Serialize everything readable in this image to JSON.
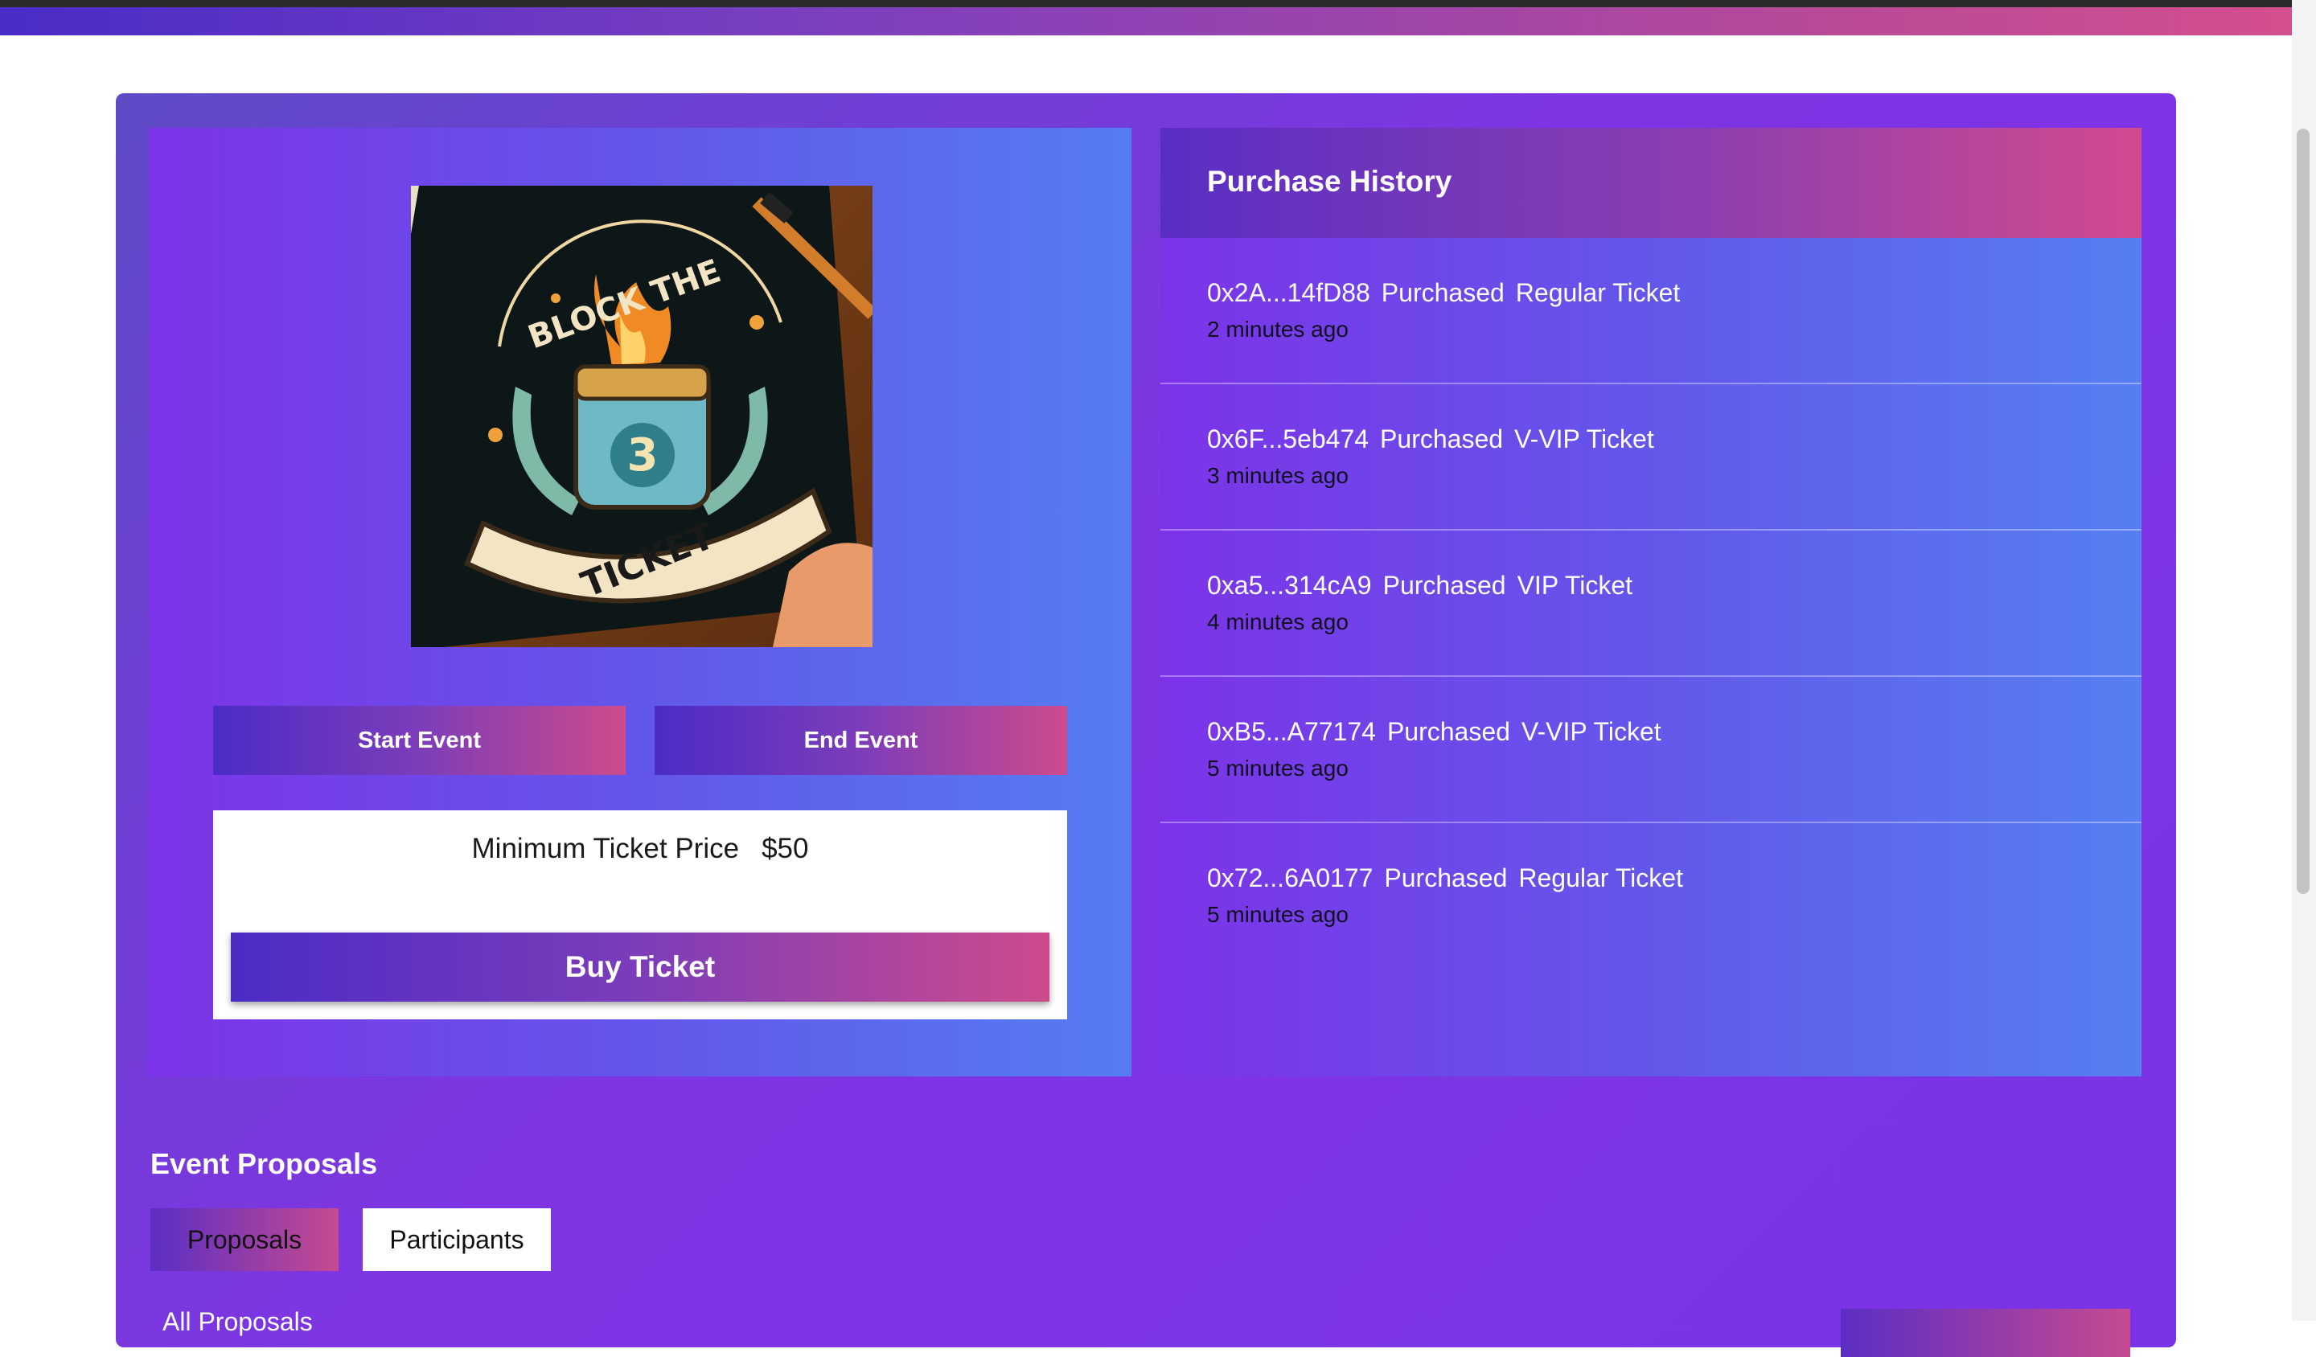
{
  "event": {
    "image_alt": "BLOCK THE 3 TICKET",
    "logo_text_top": "BLOCK THE",
    "logo_number": "3",
    "logo_text_bottom": "TICKET",
    "start_label": "Start Event",
    "end_label": "End Event",
    "min_price_label": "Minimum Ticket Price",
    "min_price_value": "$50",
    "buy_label": "Buy Ticket"
  },
  "history": {
    "title": "Purchase History",
    "items": [
      {
        "address": "0x2A...14fD88",
        "action": "Purchased",
        "ticket": "Regular Ticket",
        "time": "2 minutes ago"
      },
      {
        "address": "0x6F...5eb474",
        "action": "Purchased",
        "ticket": "V-VIP Ticket",
        "time": "3 minutes ago"
      },
      {
        "address": "0xa5...314cA9",
        "action": "Purchased",
        "ticket": "VIP Ticket",
        "time": "4 minutes ago"
      },
      {
        "address": "0xB5...A77174",
        "action": "Purchased",
        "ticket": "V-VIP Ticket",
        "time": "5 minutes ago"
      },
      {
        "address": "0x72...6A0177",
        "action": "Purchased",
        "ticket": "Regular Ticket",
        "time": "5 minutes ago"
      }
    ]
  },
  "proposals": {
    "title": "Event Proposals",
    "tabs": [
      {
        "label": "Proposals",
        "active": true
      },
      {
        "label": "Participants",
        "active": false
      }
    ],
    "list_heading": "All Proposals"
  },
  "colors": {
    "accent_start": "#4c2cc6",
    "accent_end": "#cd4b8c",
    "panel_purple": "#7d33e8",
    "panel_blue": "#557df1"
  }
}
